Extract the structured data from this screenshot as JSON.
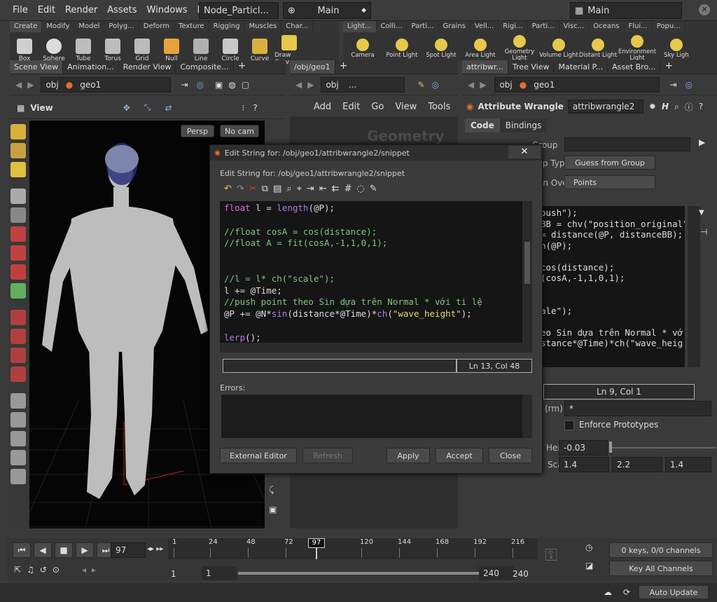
{
  "menu": [
    "File",
    "Edit",
    "Render",
    "Assets",
    "Windows",
    "Help"
  ],
  "desktop_tab": "Node_Particl...",
  "desktop_name": "Main",
  "desktop_right": "Main",
  "shelf_left_tabs": [
    "Create",
    "Modify",
    "Model",
    "Polyg...",
    "Deform",
    "Texture",
    "Rigging",
    "Muscles",
    "Char..."
  ],
  "shelf_left_tools": [
    "Box",
    "Sphere",
    "Tube",
    "Torus",
    "Grid",
    "Null",
    "Line",
    "Circle",
    "Curve",
    "Draw Curv"
  ],
  "shelf_right_tabs": [
    "Light...",
    "Colli...",
    "Parti...",
    "Grains",
    "Vell...",
    "Rigi...",
    "Parti...",
    "Visc...",
    "Oceans",
    "Flui...",
    "Popu..."
  ],
  "shelf_right_tools": [
    "Camera",
    "Point Light",
    "Spot Light",
    "Area Light",
    "Geometry Light",
    "Volume Light",
    "Distant Light",
    "Environment Light",
    "Sky Ligh"
  ],
  "left_tabs": [
    "Scene View",
    "Animation...",
    "Render View",
    "Composite..."
  ],
  "mid_tabs": [
    "/obj/geo1"
  ],
  "right_tabs": [
    "attribwr...",
    "Tree View",
    "Material P...",
    "Asset Bro..."
  ],
  "path_obj": "obj",
  "path_geo": "geo1",
  "mid_path_obj": "obj",
  "mid_path_more": "...",
  "view_label": "View",
  "persp": "Persp",
  "nocam": "No cam",
  "mid_menu": [
    "Add",
    "Edit",
    "Go",
    "View",
    "Tools"
  ],
  "geometry_watermark": "Geometry",
  "node_type": "Attribute Wrangle",
  "node_name": "attribwrangle2",
  "param_tabs": [
    "Code",
    "Bindings"
  ],
  "params": {
    "group_label": "Group",
    "group_type_label": "Group Type",
    "group_type_value": "Guess from Group",
    "run_over_label": "Run Over",
    "run_over_value": "Points",
    "rm_label": "(rm)",
    "rm_value": "*",
    "enforce": "Enforce Prototypes",
    "height_label": "Height",
    "height_value": "-0.03",
    "scale_label": "Scale",
    "scale_values": [
      "1.4",
      "2.2",
      "1.4"
    ],
    "ln_col": "Ln 9, Col 1"
  },
  "bg_code": [
    "push\");",
    "BB = chv(\"position_original\");",
    "= distance(@P, distanceBB);",
    "h(@P);",
    "",
    "cos(distance);",
    "(cosA,-1,1,0,1);",
    "",
    "",
    "ale\");",
    "",
    "eo Sin dựa trên Normal * vớ",
    "stance*@Time)*ch(\"wave_heig"
  ],
  "dialog": {
    "title": "Edit String for: /obj/geo1/attribwrangle2/snippet",
    "subtitle": "Edit String for: /obj/geo1/attribwrangle2/snippet",
    "ln_col": "Ln 13, Col 48",
    "errors_label": "Errors:",
    "buttons": [
      "External Editor",
      "Refresh",
      "Apply",
      "Accept",
      "Close"
    ]
  },
  "code_lines": [
    [
      {
        "c": "kw",
        "t": "float"
      },
      {
        "c": "",
        "t": " l = "
      },
      {
        "c": "fn",
        "t": "length"
      },
      {
        "c": "",
        "t": "(@P);"
      }
    ],
    [],
    [
      {
        "c": "cm",
        "t": "//float cosA = cos(distance);"
      }
    ],
    [
      {
        "c": "cm",
        "t": "//float A = fit(cosA,-1,1,0,1);"
      }
    ],
    [],
    [],
    [
      {
        "c": "cm",
        "t": "//l = l* ch(\"scale\");"
      }
    ],
    [
      {
        "c": "",
        "t": "l += @Time;"
      }
    ],
    [
      {
        "c": "cm",
        "t": "//push point theo Sin dựa trên Normal * với ti lệ"
      }
    ],
    [
      {
        "c": "",
        "t": "@P += @N*"
      },
      {
        "c": "fn",
        "t": "sin"
      },
      {
        "c": "",
        "t": "(distance*@Time)*"
      },
      {
        "c": "fn",
        "t": "ch"
      },
      {
        "c": "",
        "t": "("
      },
      {
        "c": "st",
        "t": "\"wave_height\""
      },
      {
        "c": "",
        "t": ");"
      }
    ],
    [],
    [
      {
        "c": "fn",
        "t": "lerp"
      },
      {
        "c": "",
        "t": "();"
      }
    ]
  ],
  "timeline": {
    "frame": "97",
    "marker": "97",
    "ticks": [
      "1",
      "24",
      "48",
      "72",
      "120",
      "144",
      "168",
      "192",
      "216"
    ],
    "start": "1",
    "start2": "1",
    "end": "240",
    "end2": "240",
    "keys": "0 keys, 0/0 channels",
    "key_all": "Key All Channels",
    "auto_update": "Auto Update"
  }
}
